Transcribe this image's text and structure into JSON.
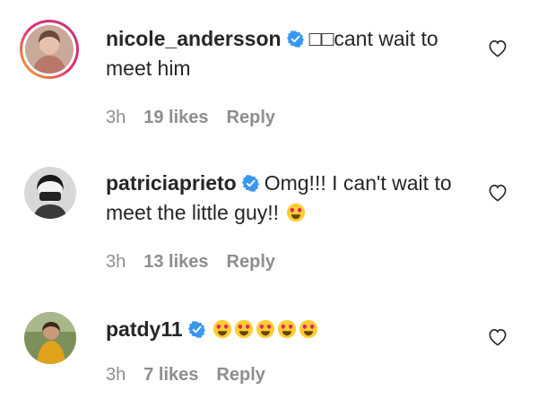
{
  "comments": [
    {
      "username": "nicole_andersson",
      "text": "□□cant wait to meet him",
      "time": "3h",
      "likes": "19 likes",
      "reply": "Reply"
    },
    {
      "username": "patriciaprieto",
      "text": "Omg!!! I can't wait to meet the little guy!!",
      "emoji_count": 1,
      "time": "3h",
      "likes": "13 likes",
      "reply": "Reply"
    },
    {
      "username": "patdy11",
      "text": "",
      "emoji_count": 5,
      "time": "3h",
      "likes": "7 likes",
      "reply": "Reply"
    }
  ],
  "icons": {
    "verified": "verified-badge-icon",
    "like": "heart-outline-icon",
    "emoji": "heart-eyes-emoji-icon"
  },
  "colors": {
    "verified": "#3897f0",
    "meta": "#8e8e8e",
    "text": "#262626"
  }
}
